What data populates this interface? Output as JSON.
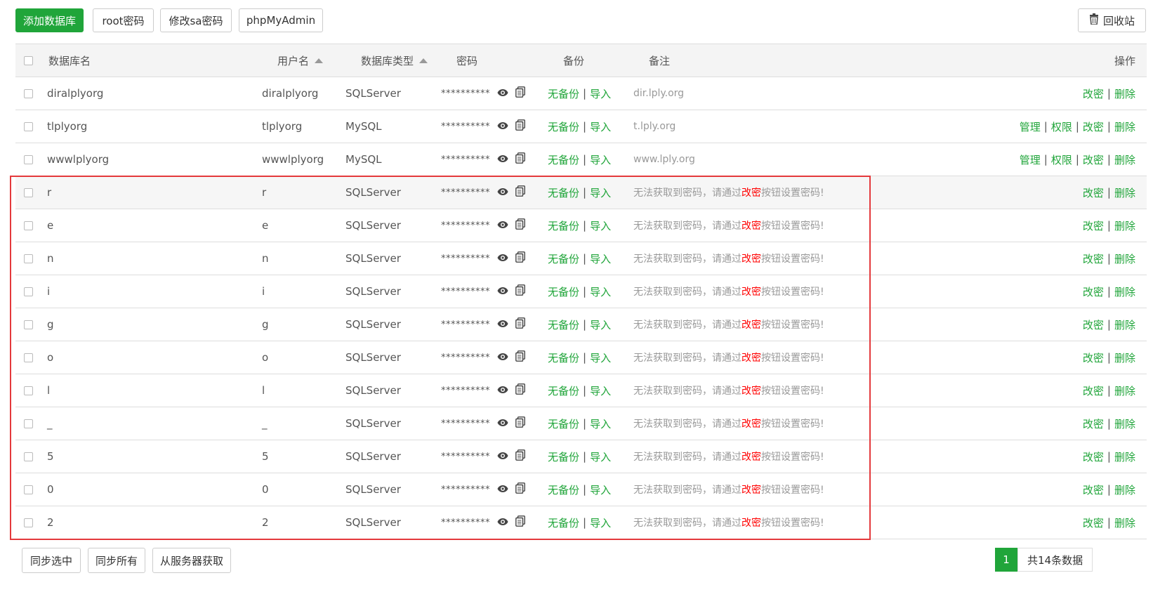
{
  "toolbar": {
    "add_db": "添加数据库",
    "root_pw": "root密码",
    "sa_pw": "修改sa密码",
    "phpmyadmin": "phpMyAdmin",
    "recycle": "回收站"
  },
  "columns": {
    "name": "数据库名",
    "user": "用户名",
    "type": "数据库类型",
    "password": "密码",
    "backup": "备份",
    "note": "备注",
    "actions": "操作"
  },
  "rows": [
    {
      "name": "diralplyorg",
      "user": "diralplyorg",
      "type": "SQLServer",
      "password": "**********",
      "backup": "无备份",
      "import": "导入",
      "note": "dir.lply.org",
      "error": false,
      "actions": [
        "改密",
        "删除"
      ]
    },
    {
      "name": "tlplyorg",
      "user": "tlplyorg",
      "type": "MySQL",
      "password": "**********",
      "backup": "无备份",
      "import": "导入",
      "note": "t.lply.org",
      "error": false,
      "actions": [
        "管理",
        "权限",
        "改密",
        "删除"
      ]
    },
    {
      "name": "wwwlplyorg",
      "user": "wwwlplyorg",
      "type": "MySQL",
      "password": "**********",
      "backup": "无备份",
      "import": "导入",
      "note": "www.lply.org",
      "error": false,
      "actions": [
        "管理",
        "权限",
        "改密",
        "删除"
      ]
    },
    {
      "name": "r",
      "user": "r",
      "type": "SQLServer",
      "password": "**********",
      "backup": "无备份",
      "import": "导入",
      "error": true,
      "actions": [
        "改密",
        "删除"
      ]
    },
    {
      "name": "e",
      "user": "e",
      "type": "SQLServer",
      "password": "**********",
      "backup": "无备份",
      "import": "导入",
      "error": true,
      "actions": [
        "改密",
        "删除"
      ]
    },
    {
      "name": "n",
      "user": "n",
      "type": "SQLServer",
      "password": "**********",
      "backup": "无备份",
      "import": "导入",
      "error": true,
      "actions": [
        "改密",
        "删除"
      ]
    },
    {
      "name": "i",
      "user": "i",
      "type": "SQLServer",
      "password": "**********",
      "backup": "无备份",
      "import": "导入",
      "error": true,
      "actions": [
        "改密",
        "删除"
      ]
    },
    {
      "name": "g",
      "user": "g",
      "type": "SQLServer",
      "password": "**********",
      "backup": "无备份",
      "import": "导入",
      "error": true,
      "actions": [
        "改密",
        "删除"
      ]
    },
    {
      "name": "o",
      "user": "o",
      "type": "SQLServer",
      "password": "**********",
      "backup": "无备份",
      "import": "导入",
      "error": true,
      "actions": [
        "改密",
        "删除"
      ]
    },
    {
      "name": "l",
      "user": "l",
      "type": "SQLServer",
      "password": "**********",
      "backup": "无备份",
      "import": "导入",
      "error": true,
      "actions": [
        "改密",
        "删除"
      ]
    },
    {
      "name": "_",
      "user": "_",
      "type": "SQLServer",
      "password": "**********",
      "backup": "无备份",
      "import": "导入",
      "error": true,
      "actions": [
        "改密",
        "删除"
      ]
    },
    {
      "name": "5",
      "user": "5",
      "type": "SQLServer",
      "password": "**********",
      "backup": "无备份",
      "import": "导入",
      "error": true,
      "actions": [
        "改密",
        "删除"
      ]
    },
    {
      "name": "0",
      "user": "0",
      "type": "SQLServer",
      "password": "**********",
      "backup": "无备份",
      "import": "导入",
      "error": true,
      "actions": [
        "改密",
        "删除"
      ]
    },
    {
      "name": "2",
      "user": "2",
      "type": "SQLServer",
      "password": "**********",
      "backup": "无备份",
      "import": "导入",
      "error": true,
      "actions": [
        "改密",
        "删除"
      ]
    }
  ],
  "error_note": {
    "prefix": "无法获取到密码，请通过",
    "link": "改密",
    "suffix": "按钮设置密码!"
  },
  "icons": {
    "show_password": "eye-icon",
    "copy_password": "copy-icon",
    "recycle": "trash-icon"
  },
  "footer": {
    "sync_selected": "同步选中",
    "sync_all": "同步所有",
    "fetch_server": "从服务器获取",
    "page": "1",
    "total": "共14条数据"
  },
  "colors": {
    "accent": "#20a53a",
    "highlight_border": "#e4393c",
    "error_link": "#ff0000"
  }
}
